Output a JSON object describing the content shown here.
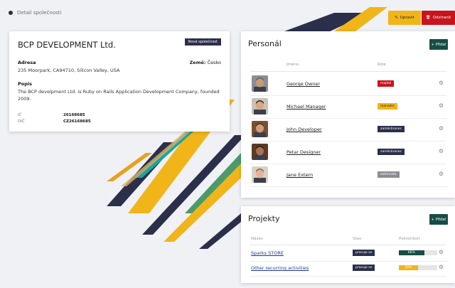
{
  "breadcrumb": {
    "label": "Detail společnosti"
  },
  "actions": {
    "edit_label": "Upravit",
    "delete_label": "Odstranit"
  },
  "company": {
    "name": "BCP DEVELOPMENT Ltd.",
    "badge": "Nová společnost",
    "address_label": "Adresa",
    "address": "235 Moorpark, CA94710, Silicon Valley, USA",
    "country_label": "Země:",
    "country": "Česko",
    "description_label": "Popis",
    "description": "The BCP develpment Ltd. is Ruby on Rails Application Development Company, founded 2009.",
    "ids": [
      {
        "key": "IČ",
        "value": "26168685"
      },
      {
        "key": "DIČ",
        "value": "CZ26168685"
      }
    ]
  },
  "personal": {
    "title": "Personál",
    "add_label": "Přidat",
    "columns": {
      "name": "Jméno",
      "role": "Role"
    },
    "rows": [
      {
        "name": "George Owner",
        "role": "majitel",
        "role_color": "#c8141c",
        "role_text": "#ffffff",
        "avatar_skin": "#c99a7a",
        "avatar_hair": "#6b5a4a",
        "avatar_bg": "#8a8f96"
      },
      {
        "name": "Michael Manager",
        "role": "manažer",
        "role_color": "#f1b51a",
        "role_text": "#222222",
        "avatar_skin": "#d8a786",
        "avatar_hair": "#2a1f18",
        "avatar_bg": "#c9c2b6"
      },
      {
        "name": "John Developer",
        "role": "zaměstnanec",
        "role_color": "#2b2f4a",
        "role_text": "#ffffff",
        "avatar_skin": "#d19a78",
        "avatar_hair": "#3a2a1e",
        "avatar_bg": "#7a5030"
      },
      {
        "name": "Petar Designer",
        "role": "zaměstnanec",
        "role_color": "#2b2f4a",
        "role_text": "#ffffff",
        "avatar_skin": "#a87356",
        "avatar_hair": "#1e1612",
        "avatar_bg": "#5b3b24"
      },
      {
        "name": "Jane Extern",
        "role": "externista",
        "role_color": "#8a8d93",
        "role_text": "#ffffff",
        "avatar_skin": "#e2b59a",
        "avatar_hair": "#8c5a34",
        "avatar_bg": "#d7d2c8"
      }
    ]
  },
  "projects": {
    "title": "Projekty",
    "add_label": "Přidat",
    "columns": {
      "name": "Název",
      "state": "Stav",
      "progress": "Pokročilost"
    },
    "rows": [
      {
        "name": "Sparks STORE",
        "state": "pracuje se",
        "progress": 66,
        "progress_label": "66%",
        "color": "#174d45"
      },
      {
        "name": "Other recurring activities",
        "state": "pracuje se",
        "progress": 50,
        "progress_label": "50%",
        "color": "#f1b51a"
      }
    ]
  },
  "colors": {
    "accent_green": "#174d45",
    "yellow": "#f1b51a",
    "red": "#c8141c",
    "navy": "#2b2f4a"
  }
}
